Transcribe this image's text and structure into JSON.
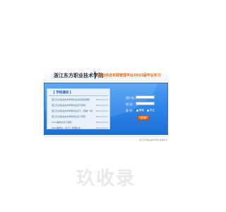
{
  "header": {
    "school_name": "浙江东方职业技术学院",
    "platform_title": "毕业综合实践管理平台2023届毕业实习"
  },
  "notices": {
    "title": "【 学校通知 】",
    "items": [
      {
        "title": "浙江东方职业技术学院毕业综合实践通知",
        "date": "2023-02-27"
      },
      {
        "title": "浙江东方职业技术学院毕业实习安排",
        "date": "2023-02-27"
      },
      {
        "title": "浙江东方职业技术学院毕业实习（顶岗）管理办法通知",
        "date": "2023-02-27"
      },
      {
        "title": "浙江东方职业技术学院学生实习须知",
        "date": "2023-02-27"
      },
      {
        "title": "2023届毕业实习通知",
        "date": "2023-02-27"
      },
      {
        "title": "2023届毕业（实习）管理办法",
        "date": "2023-02-27"
      }
    ]
  },
  "login": {
    "username_label": "用户名：",
    "password_label": "密 码：",
    "role_label": "身 份：",
    "role_student": "教师",
    "role_teacher": "学生",
    "submit_label": "登 录"
  },
  "footer": {
    "credit": "浙江东方职业技术学院 版权所有"
  },
  "watermark": "玖收录",
  "colors": {
    "panel_blue": "#2f86e9",
    "title_orange": "#e06b12",
    "button_orange": "#f0651a"
  }
}
